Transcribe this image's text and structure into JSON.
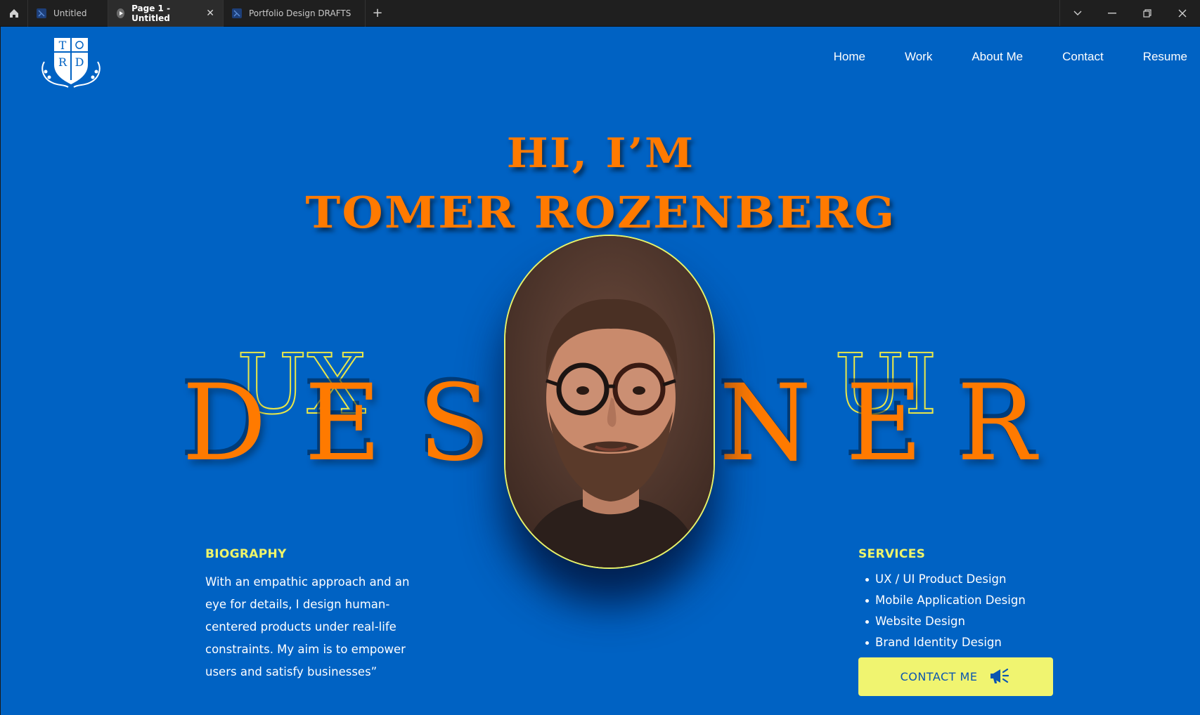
{
  "chrome": {
    "tabs": [
      {
        "label": "Untitled",
        "active": false
      },
      {
        "label": "Page 1 - Untitled",
        "active": true
      },
      {
        "label": "Portfolio Design DRAFTS",
        "active": false
      }
    ],
    "add_tab": "+"
  },
  "site": {
    "background": "#0062c3",
    "accent": "#ff7a00",
    "highlight": "#eef46a",
    "logo": {
      "letters": [
        "T",
        "R",
        "D"
      ]
    },
    "nav": [
      "Home",
      "Work",
      "About Me",
      "Contact",
      "Resume"
    ],
    "hero": {
      "line1": "HI, I’M",
      "line2": "TOMER ROZENBERG"
    },
    "designer_letters": [
      "D",
      "E",
      "S",
      "N",
      "E",
      "R"
    ],
    "outline_left": "UX",
    "outline_right": "UI",
    "biography": {
      "heading": "BIOGRAPHY",
      "text": "With an empathic approach and an eye for details, I design human-centered products under real-life constraints. My aim is to empower users and satisfy businesses”"
    },
    "services": {
      "heading": "SERVICES",
      "items": [
        "UX / UI Product Design",
        "Mobile Application Design",
        "Website Design",
        "Brand Identity Design"
      ]
    },
    "contact_button": "CONTACT ME"
  }
}
